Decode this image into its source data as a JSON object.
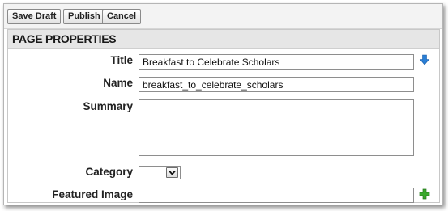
{
  "toolbar": {
    "save_draft": "Save Draft",
    "publish": "Publish",
    "cancel": "Cancel"
  },
  "panel": {
    "header": "PAGE PROPERTIES"
  },
  "fields": {
    "title": {
      "label": "Title",
      "value": "Breakfast to Celebrate Scholars"
    },
    "name": {
      "label": "Name",
      "value": "breakfast_to_celebrate_scholars"
    },
    "summary": {
      "label": "Summary",
      "value": ""
    },
    "category": {
      "label": "Category",
      "value": ""
    },
    "featured_image": {
      "label": "Featured Image",
      "value": ""
    }
  },
  "icons": {
    "title_action": "down-arrow-icon",
    "featured_image_action": "plus-icon"
  },
  "colors": {
    "arrow_blue": "#2a7fd6",
    "plus_green": "#3aa82c"
  }
}
